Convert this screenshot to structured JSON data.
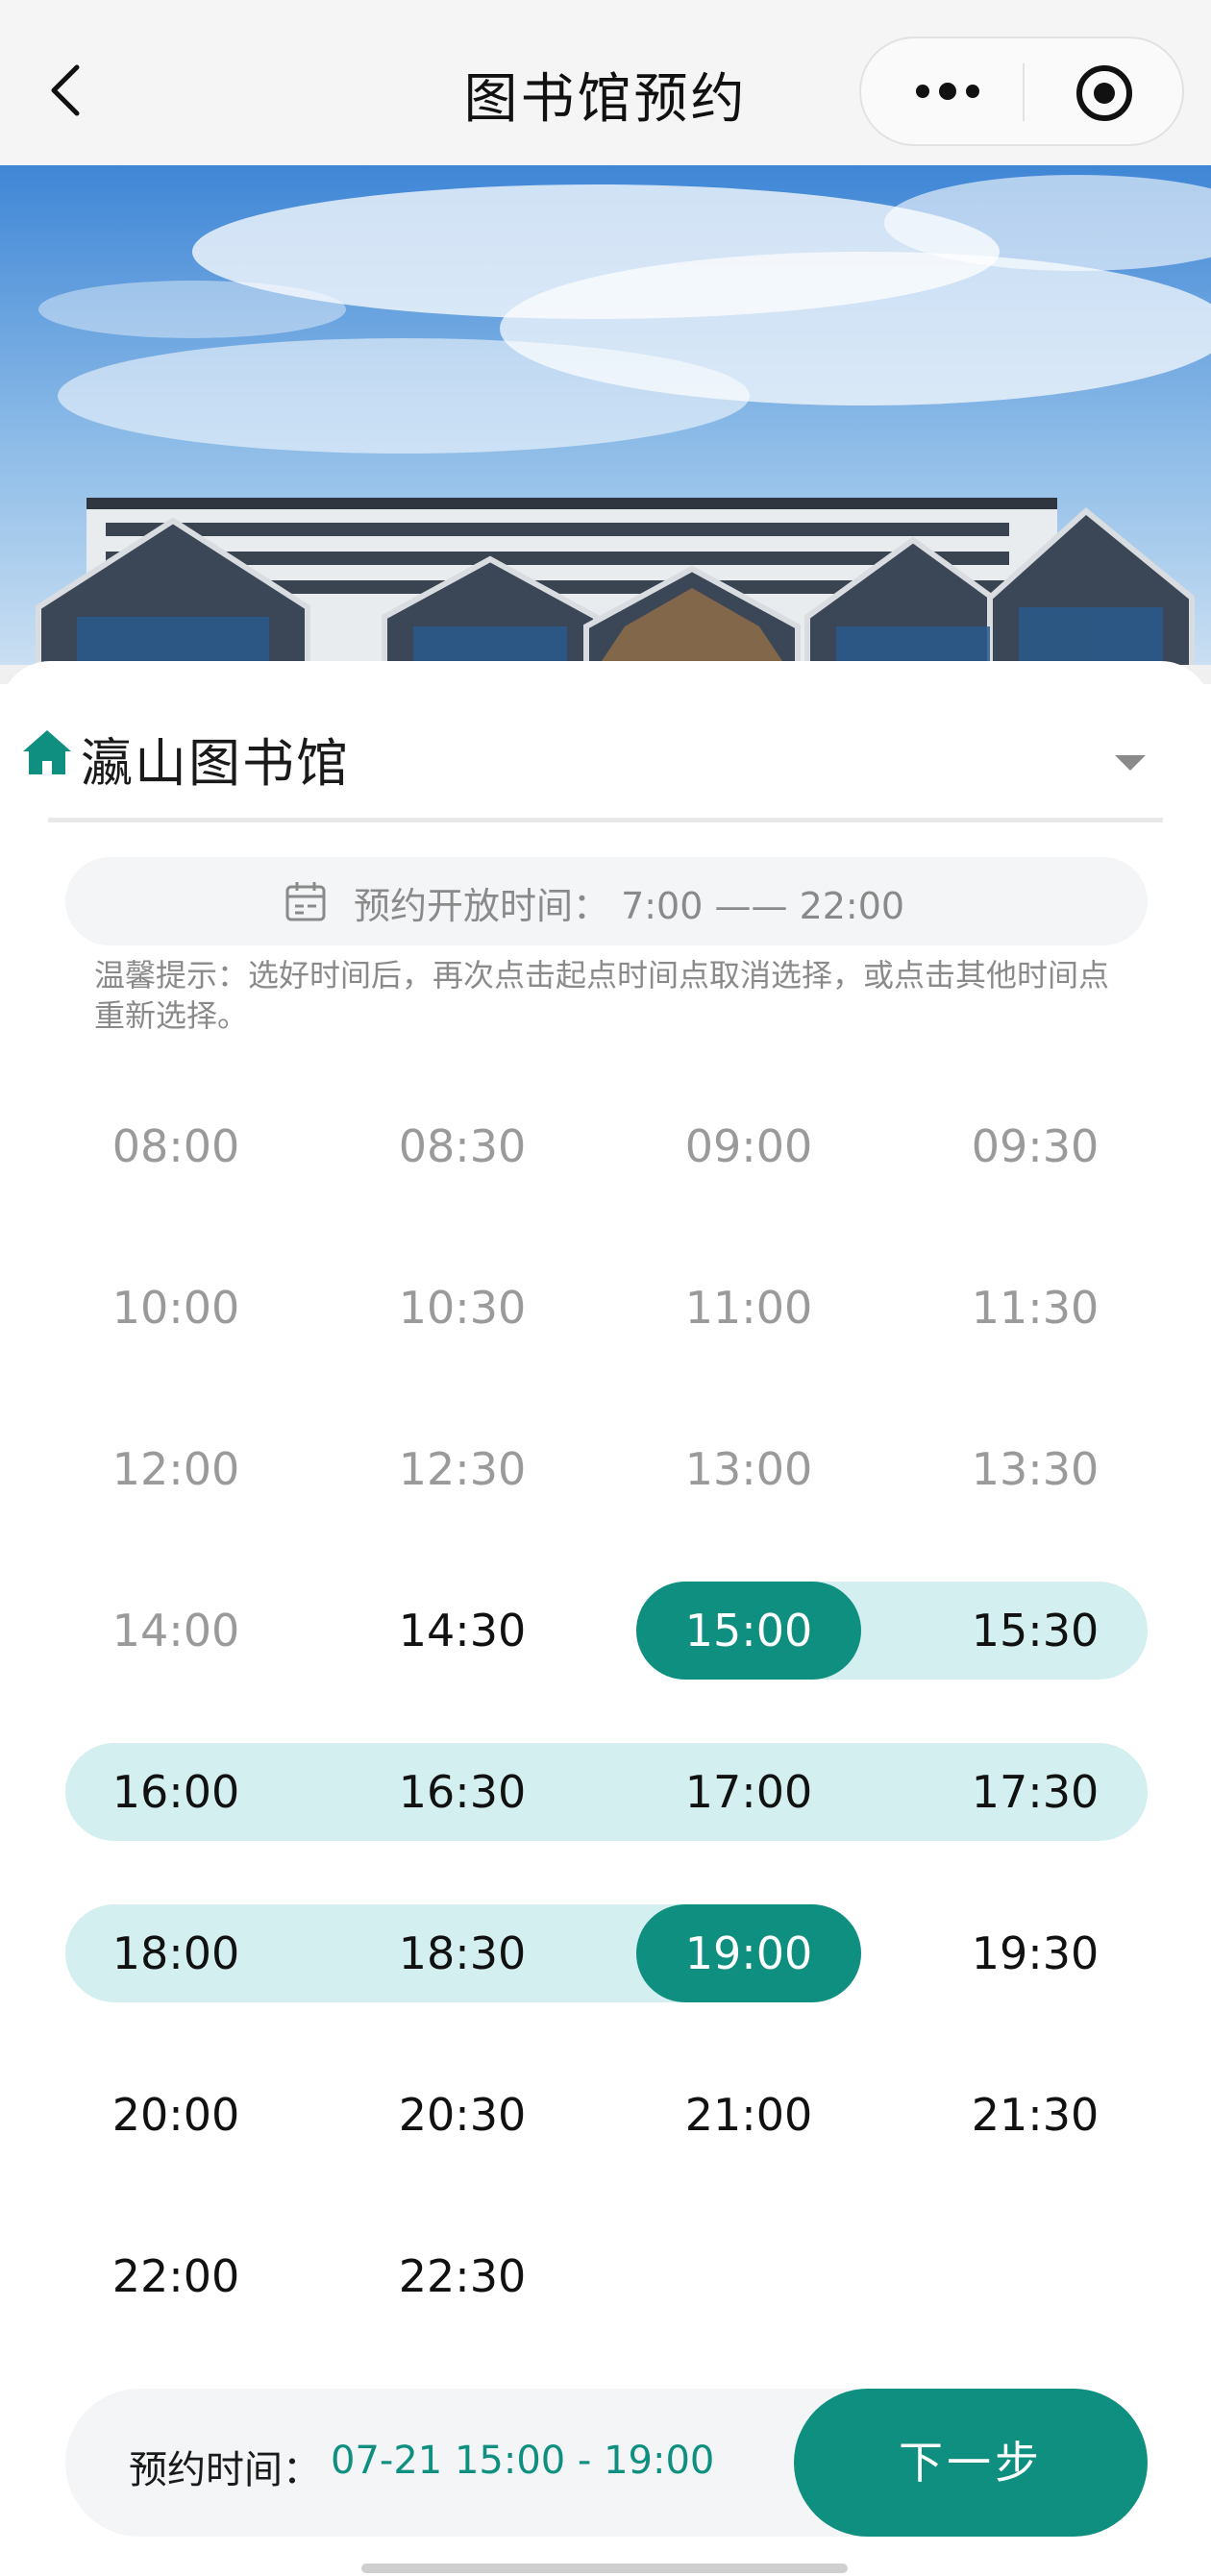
{
  "navbar": {
    "title": "图书馆预约"
  },
  "library": {
    "name": "瀛山图书馆"
  },
  "hours": {
    "text": "预约开放时间：  7:00 —— 22:00"
  },
  "tip": {
    "text": "温馨提示：选好时间后，再次点击起点时间点取消选择，或点击其他时间点重新选择。"
  },
  "slots": {
    "s0800": "08:00",
    "s0830": "08:30",
    "s0900": "09:00",
    "s0930": "09:30",
    "s1000": "10:00",
    "s1030": "10:30",
    "s1100": "11:00",
    "s1130": "11:30",
    "s1200": "12:00",
    "s1230": "12:30",
    "s1300": "13:00",
    "s1330": "13:30",
    "s1400": "14:00",
    "s1430": "14:30",
    "s1500": "15:00",
    "s1530": "15:30",
    "s1600": "16:00",
    "s1630": "16:30",
    "s1700": "17:00",
    "s1730": "17:30",
    "s1800": "18:00",
    "s1830": "18:30",
    "s1900": "19:00",
    "s1930": "19:30",
    "s2000": "20:00",
    "s2030": "20:30",
    "s2100": "21:00",
    "s2130": "21:30",
    "s2200": "22:00",
    "s2230": "22:30"
  },
  "selection": {
    "label": "预约时间：",
    "value": "07-21 15:00 - 19:00"
  },
  "actions": {
    "next_label": "下一步"
  },
  "colors": {
    "accent": "#0f8f80",
    "range_bg": "#d3efef",
    "past_text": "#9a9a9a"
  }
}
